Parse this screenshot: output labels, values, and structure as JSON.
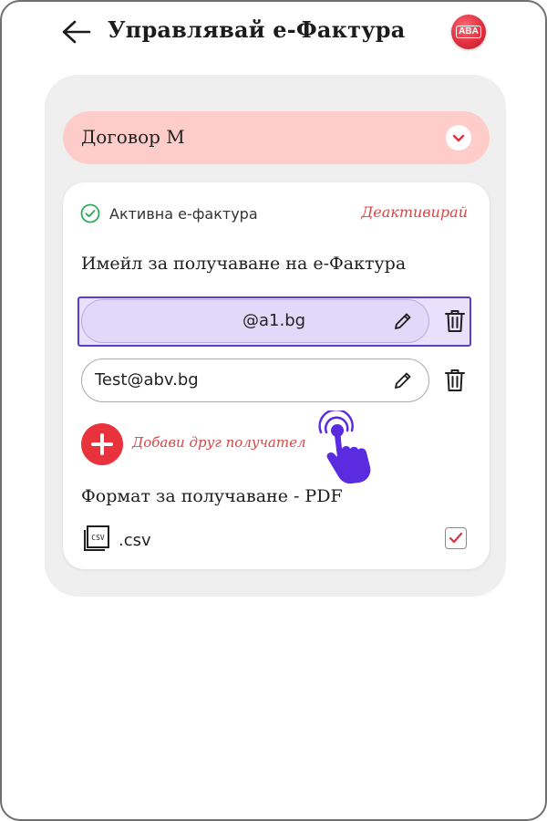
{
  "header": {
    "title": "Управлявай е-Фактура",
    "logo_text": "ABA",
    "icons": {
      "back": "arrow-left-icon",
      "logo": "brand-logo"
    }
  },
  "contract": {
    "label": "Договор М",
    "icon": "chevron-down-icon"
  },
  "status": {
    "text": "Активна е-фактура",
    "action": "Деактивирай",
    "icon": "check-circle-icon"
  },
  "email_section": {
    "title": "Имейл за получаване на е-Фактура",
    "emails": [
      {
        "value": "@a1.bg",
        "selected": true
      },
      {
        "value": "Test@abv.bg",
        "selected": false
      }
    ],
    "icons": {
      "edit": "pencil-icon",
      "delete": "trash-icon"
    },
    "add_label": "Добави друг получател"
  },
  "format_section": {
    "title": "Формат за получаване - PDF",
    "option_label": ".csv",
    "option_icon_text": "CSV",
    "checked": true
  },
  "colors": {
    "accent_red": "#e8323c",
    "link_red": "#d84646",
    "contract_bg": "#ffcdc9",
    "selection_border": "#5a3fc0",
    "selection_bg": "#e9e1fb",
    "hand_cursor": "#5b2be0",
    "status_green": "#2eaa5c"
  }
}
